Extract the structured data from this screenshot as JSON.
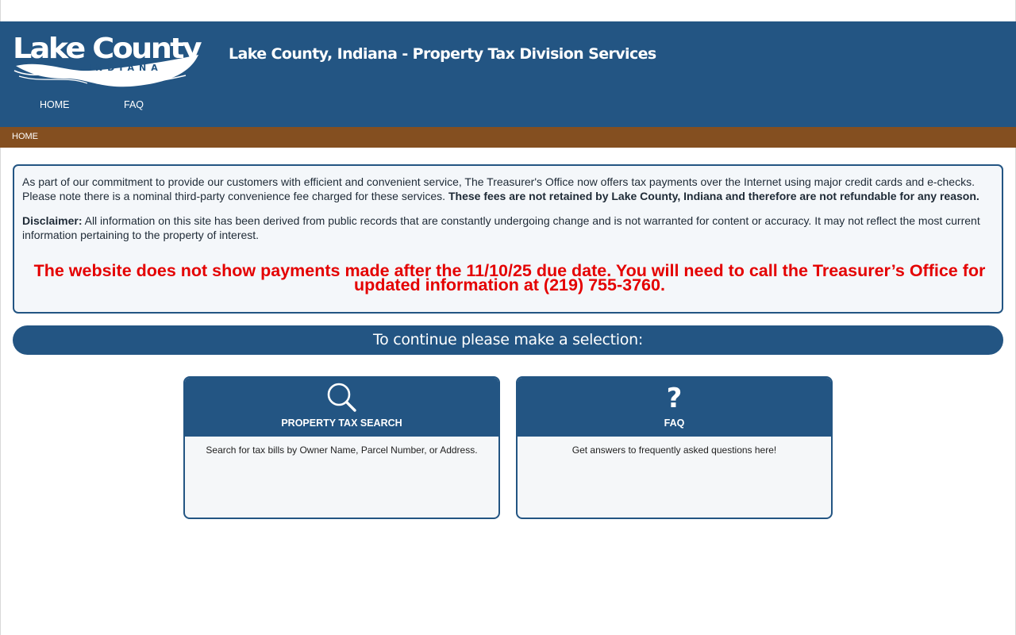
{
  "header": {
    "logo_text": "Lake County",
    "logo_subtext": "INDIANA",
    "title": "Lake County, Indiana - Property Tax Division Services"
  },
  "nav": {
    "items": [
      {
        "label": "HOME"
      },
      {
        "label": "FAQ"
      }
    ]
  },
  "breadcrumb": {
    "current": "HOME"
  },
  "notice": {
    "intro_text": "As part of our commitment to provide our customers with efficient and convenient service, The Treasurer's Office now offers tax payments over the Internet using major credit cards and e-checks. Please note there is a nominal third-party convenience fee charged for these services.",
    "intro_bold": "These fees are not retained by Lake County, Indiana and therefore are not refundable for any reason.",
    "disclaimer_label": "Disclaimer:",
    "disclaimer_text": "All information on this site has been derived from public records that are constantly undergoing change and is not warranted for content or accuracy. It may not reflect the most current information pertaining to the property of interest.",
    "warning": "The website does not show payments made after the 11/10/25 due date. You will need to call the Treasurer’s Office for updated information at (219) 755-3760."
  },
  "selection_prompt": "To continue please make a selection:",
  "cards": [
    {
      "icon": "search-icon",
      "title": "PROPERTY TAX SEARCH",
      "description": "Search for tax bills by Owner Name, Parcel Number, or Address."
    },
    {
      "icon": "question-mark-icon",
      "icon_glyph": "?",
      "title": "FAQ",
      "description": "Get answers to frequently asked questions here!"
    }
  ],
  "colors": {
    "primary_blue": "#235583",
    "breadcrumb_brown": "#844f20",
    "warning_red": "#e40000",
    "panel_bg": "#f4f7fa"
  }
}
